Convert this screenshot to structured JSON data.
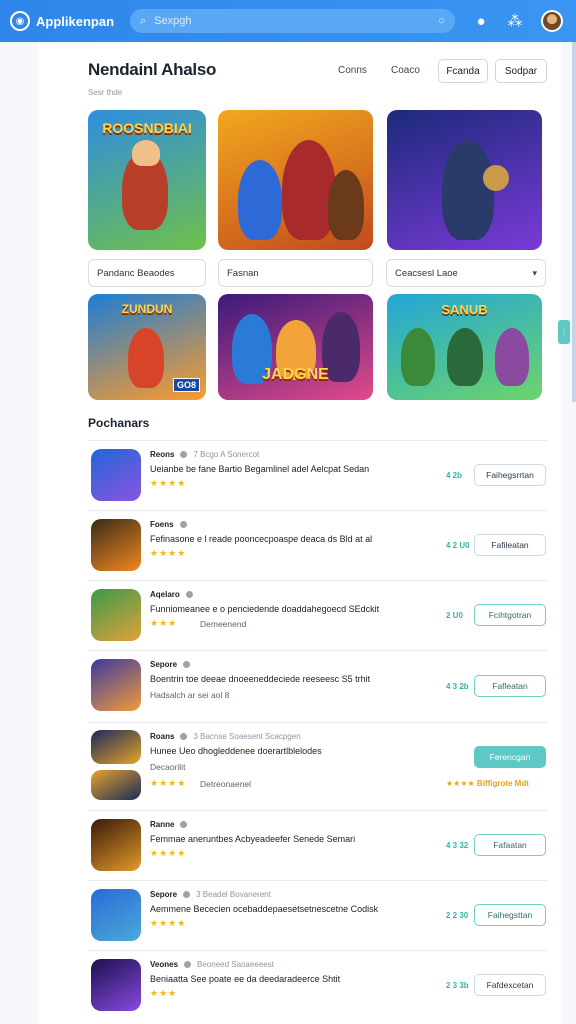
{
  "header": {
    "brand": "Applikenpan",
    "search_placeholder": "Sexpgh",
    "icons": [
      "search-icon",
      "grid-icon",
      "avatar"
    ]
  },
  "page": {
    "title": "Nendainl Ahalso",
    "subtitle": "Sesr thde",
    "links": [
      "Conns",
      "Coaco"
    ],
    "buttons": [
      "Fcanda",
      "Sodpar"
    ]
  },
  "filters": [
    {
      "label": "Pandanc Beaodes",
      "chevron": false
    },
    {
      "label": "Fasnan",
      "chevron": false
    },
    {
      "label": "Ceacsesl Laoe",
      "chevron": true
    }
  ],
  "featured": [
    {
      "caption": "ROOSNDBIAI",
      "colors": [
        "#2f8de0",
        "#6fc04a"
      ]
    },
    {
      "caption": "",
      "colors": [
        "#f2a81d",
        "#c24a1f"
      ]
    },
    {
      "caption": "",
      "colors": [
        "#1c2a7a",
        "#7a3ad8"
      ]
    },
    {
      "caption": "ZUNDUN",
      "badge": "GO8",
      "colors": [
        "#1b7ed6",
        "#ff9a2a"
      ]
    },
    {
      "caption": "JADGNE",
      "colors": [
        "#3a1a7a",
        "#e24a8a"
      ]
    },
    {
      "caption": "SANUB",
      "colors": [
        "#22a6d8",
        "#6cd46a"
      ]
    }
  ],
  "section_title": "Pochanars",
  "rows": [
    {
      "title": "Reons",
      "meta": "7 Bcgo A Sonercot",
      "desc": "Ueianbe be fane Bartio Begamlinel adel Aelcpat Sedan",
      "stars": "★★★★",
      "sub": "",
      "num": "4 2b",
      "button": "Faihegsrrtan",
      "style": "plain",
      "colors": [
        "#2366d8",
        "#8a54e0"
      ]
    },
    {
      "title": "Foens",
      "meta": "",
      "desc": "Fefinasone e l reade pooncecpoaspe deaca ds Bld at al",
      "stars": "★★★★",
      "sub": "",
      "num": "4 2 U0",
      "button": "Fafileatan",
      "style": "plain",
      "colors": [
        "#3a2a1a",
        "#f2891e"
      ]
    },
    {
      "title": "Aqelaro",
      "meta": "",
      "desc": "Funniomeanee e o penciedende doaddahegoecd SEdckit",
      "stars": "★★★",
      "sub": "Demeenend",
      "num": "2 U0",
      "button": "Fcihtgotran",
      "style": "teal",
      "colors": [
        "#3a9a4a",
        "#e2a13a"
      ]
    },
    {
      "title": "Sepore",
      "meta": "",
      "desc": "Boentrin toe deeae dnoeeneddeciede reeseesc S5 trhit",
      "stars": "",
      "sub": "Hadsalch ar sei aol 8",
      "num": "4 3 2b",
      "button": "Fafleatan",
      "style": "teal",
      "colors": [
        "#3a3aa0",
        "#f29a3a"
      ]
    },
    {
      "title": "Roans",
      "meta": "3 Bacnse Soaesent Scacpgen",
      "desc": "Hunee Ueo dhogleddenee doerartlblelodes",
      "stars": "★★★★",
      "sub": "Decaorilit",
      "sub2": "Detreonaenel",
      "num": "★★★★ Biffigrote Mdt",
      "button": "Ferencgan",
      "style": "fill",
      "colors": [
        "#1a2a5a",
        "#e6a42a"
      ]
    },
    {
      "title": "Ranne",
      "meta": "",
      "desc": "Femmae aneruntbes Acbyeadeefer Senede Semari",
      "stars": "★★★★",
      "sub": "",
      "num": "4 3 32",
      "button": "Fafaatan",
      "style": "teal",
      "colors": [
        "#3a1a0a",
        "#e29a2a"
      ]
    },
    {
      "title": "Sepore",
      "meta": "3 Beadel Bovanerent",
      "desc": "Aemmene Bececien ocebaddepaesetsetnescetne Codisk",
      "stars": "★★★★",
      "sub": "",
      "num": "2 2 30",
      "button": "Faihegsttan",
      "style": "teal",
      "colors": [
        "#2a6ad8",
        "#4aaad8"
      ]
    },
    {
      "title": "Veones",
      "meta": "Beoneed Saoaeeeest",
      "desc": "Beniaatta See poate ee da deedaradeerce Shtit",
      "stars": "★★★",
      "sub": "",
      "num": "2 3 3b",
      "button": "Fafdexcetan",
      "style": "plain",
      "colors": [
        "#1a1050",
        "#8a4ae0"
      ]
    }
  ]
}
